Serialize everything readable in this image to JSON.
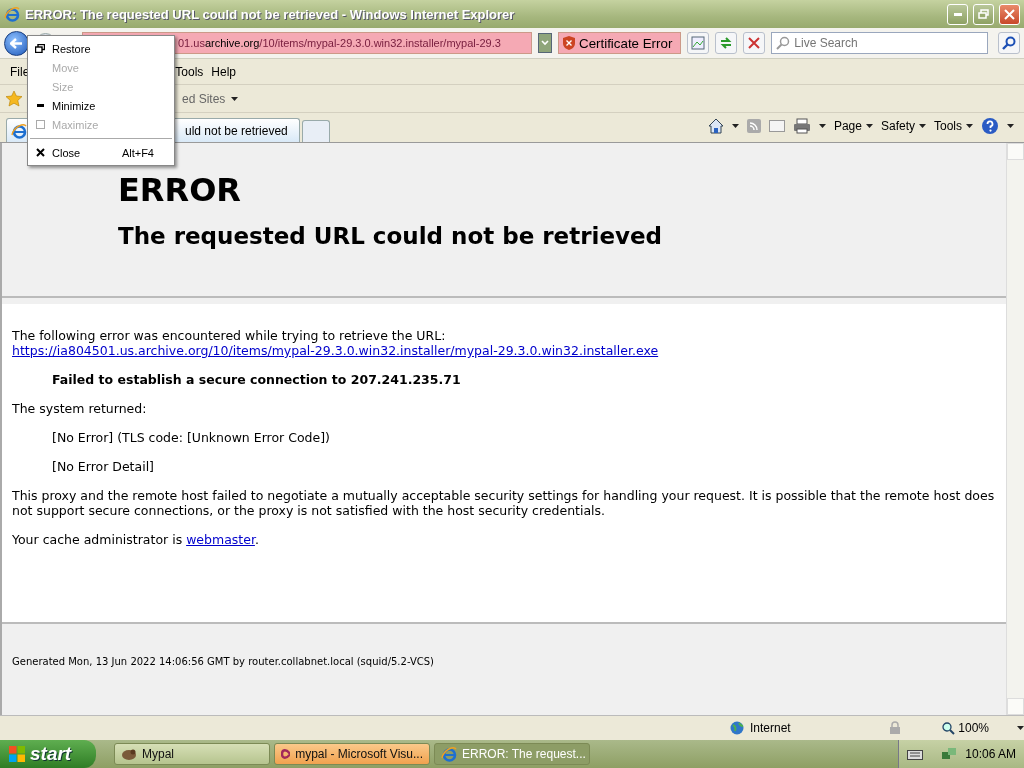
{
  "window": {
    "title": "ERROR: The requested URL could not be retrieved - Windows Internet Explorer"
  },
  "address": {
    "prefix": "01.us ",
    "domain": "archive.org",
    "path": "/10/items/mypal-29.3.0.win32.installer/mypal-29.3",
    "certificate": "Certificate Error"
  },
  "search": {
    "placeholder": "Live Search"
  },
  "menu_left": [
    "File"
  ],
  "menu_right": [
    "Tools",
    "Help"
  ],
  "favorites": {
    "label": "ed Sites"
  },
  "tabs": [
    {
      "label": "uld not be retrieved",
      "selected": true
    }
  ],
  "command_bar": [
    "Page",
    "Safety",
    "Tools"
  ],
  "page": {
    "heading": "ERROR",
    "subheading": "The requested URL could not be retrieved",
    "intro": "The following error was encountered while trying to retrieve the URL: ",
    "url": "https://ia804501.us.archive.org/10/items/mypal-29.3.0.win32.installer/mypal-29.3.0.win32.installer.exe",
    "failure": "Failed to establish a secure connection to 207.241.235.71",
    "returned": "The system returned:",
    "details": [
      "[No Error] (TLS code: [Unknown Error Code])",
      "[No Error Detail]"
    ],
    "explanation": "This proxy and the remote host failed to negotiate a mutually acceptable security settings for handling your request. It is possible that the remote host does not support secure connections, or the proxy is not satisfied with the host security credentials.",
    "admin": "Your cache administrator is ",
    "admin_link": "webmaster",
    "admin_end": ".",
    "footer": "Generated Mon, 13 Jun 2022 14:06:56 GMT by router.collabnet.local (squid/5.2-VCS)"
  },
  "status_bar": {
    "zone": "Internet",
    "zoom": "100%"
  },
  "system_menu": [
    {
      "kind": "item",
      "label": "Restore",
      "disabled": false
    },
    {
      "kind": "item",
      "label": "Move",
      "disabled": true
    },
    {
      "kind": "item",
      "label": "Size",
      "disabled": true
    },
    {
      "kind": "item",
      "label": "Minimize",
      "disabled": false
    },
    {
      "kind": "item",
      "label": "Maximize",
      "disabled": true
    },
    {
      "kind": "separator"
    },
    {
      "kind": "item",
      "label": "Close",
      "shortcut": "Alt+F4",
      "disabled": false
    }
  ],
  "taskbar": {
    "start": "start",
    "tasks": [
      {
        "label": "Mypal",
        "selected": false,
        "flashing": false
      },
      {
        "label": "mypal - Microsoft Visu...",
        "selected": false,
        "flashing": true
      },
      {
        "label": "ERROR: The request...",
        "selected": true,
        "flashing": false
      }
    ],
    "clock": "10:06 AM"
  }
}
